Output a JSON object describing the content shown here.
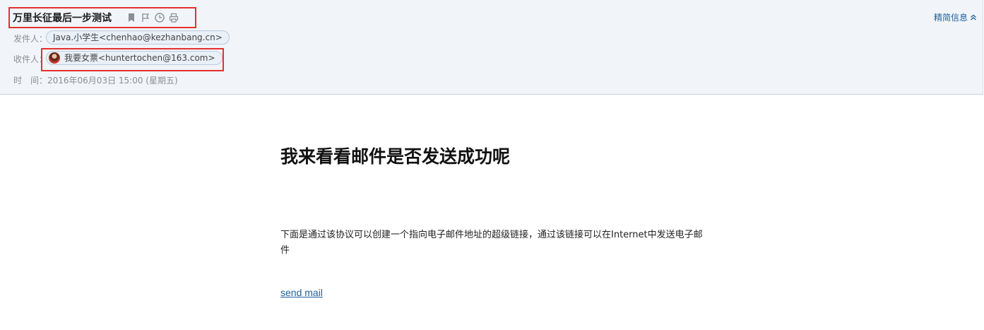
{
  "header": {
    "subject": "万里长征最后一步测试",
    "toggle_label": "精简信息",
    "sender_label": "发件人：",
    "sender": "Java.小学生<chenhao@kezhanbang.cn>",
    "recipient_label": "收件人：",
    "recipient": "我要女票<huntertochen@163.com>",
    "time_label": "时　间：",
    "time_value": "2016年06月03日 15:00 (星期五)",
    "icons": [
      "bookmark-icon",
      "flag-icon",
      "clock-icon",
      "print-icon"
    ]
  },
  "body": {
    "headline": "我来看看邮件是否发送成功呢",
    "paragraph": "下面是通过该协议可以创建一个指向电子邮件地址的超级链接，通过该链接可以在Internet中发送电子邮件",
    "link_text": "send mail"
  },
  "colors": {
    "accent_link": "#1f5f9c",
    "highlight_box": "#e53030",
    "header_bg": "#f1f4f8"
  }
}
